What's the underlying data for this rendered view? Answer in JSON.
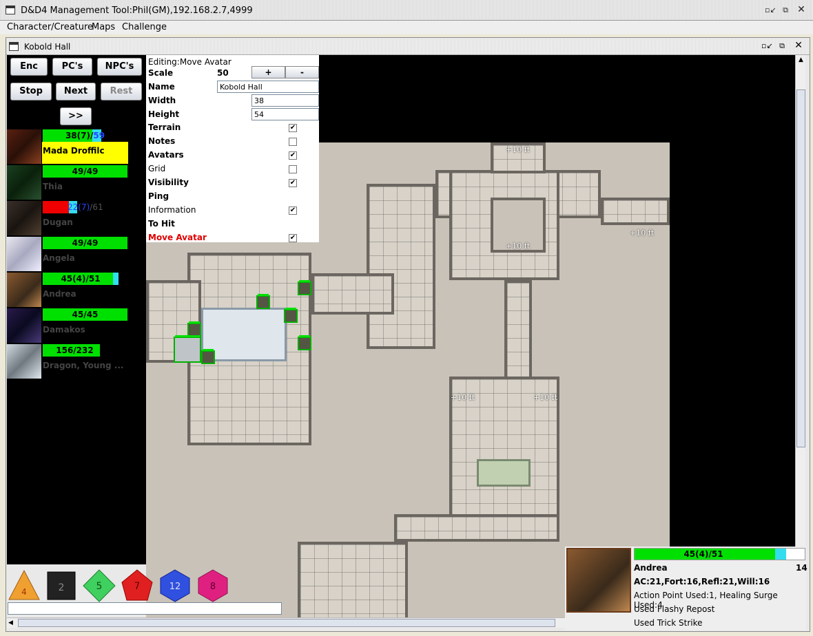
{
  "window": {
    "title": "D&D4 Management Tool:Phil(GM),192.168.2.7,4999"
  },
  "menu": {
    "items": [
      "Character/Creature",
      "Maps",
      "Challenge"
    ]
  },
  "internal_frame": {
    "title": "Kobold Hall"
  },
  "buttons": {
    "enc": "Enc",
    "pcs": "PC's",
    "npcs": "NPC's",
    "stop": "Stop",
    "next": "Next",
    "rest": "Rest",
    "expand": ">>"
  },
  "creatures": [
    {
      "name": "Mada Droffilc",
      "hp_text_a": "38(7)/",
      "hp_text_b": "59",
      "hp_current": 38,
      "hp_temp": 7,
      "hp_max": 59,
      "selected": true
    },
    {
      "name": "Thia",
      "hp_text": "49/49",
      "hp_current": 49,
      "hp_max": 49
    },
    {
      "name": "Dugan",
      "hp_text_a": "22(7)",
      "hp_text_b": "/61",
      "hp_current": 22,
      "hp_temp": 7,
      "hp_max": 61
    },
    {
      "name": "Angela",
      "hp_text": "49/49",
      "hp_current": 49,
      "hp_max": 49
    },
    {
      "name": "Andrea",
      "hp_text": "45(4)/51",
      "hp_current": 45,
      "hp_temp": 4,
      "hp_max": 51
    },
    {
      "name": "Damakos",
      "hp_text": "45/45",
      "hp_current": 45,
      "hp_max": 45
    },
    {
      "name": "Dragon, Young ...",
      "hp_text": "156/232",
      "hp_current": 156,
      "hp_max": 232
    }
  ],
  "editor": {
    "mode": "Editing:Move Avatar",
    "scale_label": "Scale",
    "scale_value": "50",
    "plus": "+",
    "minus": "-",
    "name_label": "Name",
    "name_value": "Kobold Hall",
    "width_label": "Width",
    "width_value": "38",
    "height_label": "Height",
    "height_value": "54",
    "layers": [
      {
        "label": "Terrain",
        "checked": true
      },
      {
        "label": "Notes",
        "checked": false
      },
      {
        "label": "Avatars",
        "checked": true
      },
      {
        "label": "Grid",
        "checked": false
      },
      {
        "label": "Visibility",
        "checked": true
      },
      {
        "label": "Ping",
        "checked": null
      },
      {
        "label": "Information",
        "checked": true
      },
      {
        "label": "To Hit",
        "checked": null
      },
      {
        "label": "Move Avatar",
        "checked": true
      }
    ],
    "check_glyph": "✔"
  },
  "map_labels": {
    "l1": "+10 ft",
    "l2": "+10 ft",
    "l3": "+10 ft",
    "l4": "+10 ft",
    "l5": "+10 ft"
  },
  "dice": [
    {
      "name": "d4",
      "label": "4",
      "color": "#f0a030"
    },
    {
      "name": "d6",
      "label": "2",
      "color": "#222222"
    },
    {
      "name": "d8",
      "label": "5",
      "color": "#40d060"
    },
    {
      "name": "d10",
      "label": "7",
      "color": "#e02020"
    },
    {
      "name": "d12",
      "label": "12",
      "color": "#3050e0"
    },
    {
      "name": "d20",
      "label": "8",
      "color": "#e02080"
    }
  ],
  "info": {
    "hp_text": "45(4)/51",
    "hp_current": 45,
    "hp_temp": 4,
    "hp_max": 51,
    "name": "Andrea",
    "initiative": "14",
    "defenses": "AC:21,Fort:16,Refl:21,Will:16",
    "line1": "Action Point Used:1, Healing Surge Used:4",
    "line2": "Used Flashy Repost",
    "line3": "Used Trick Strike"
  }
}
